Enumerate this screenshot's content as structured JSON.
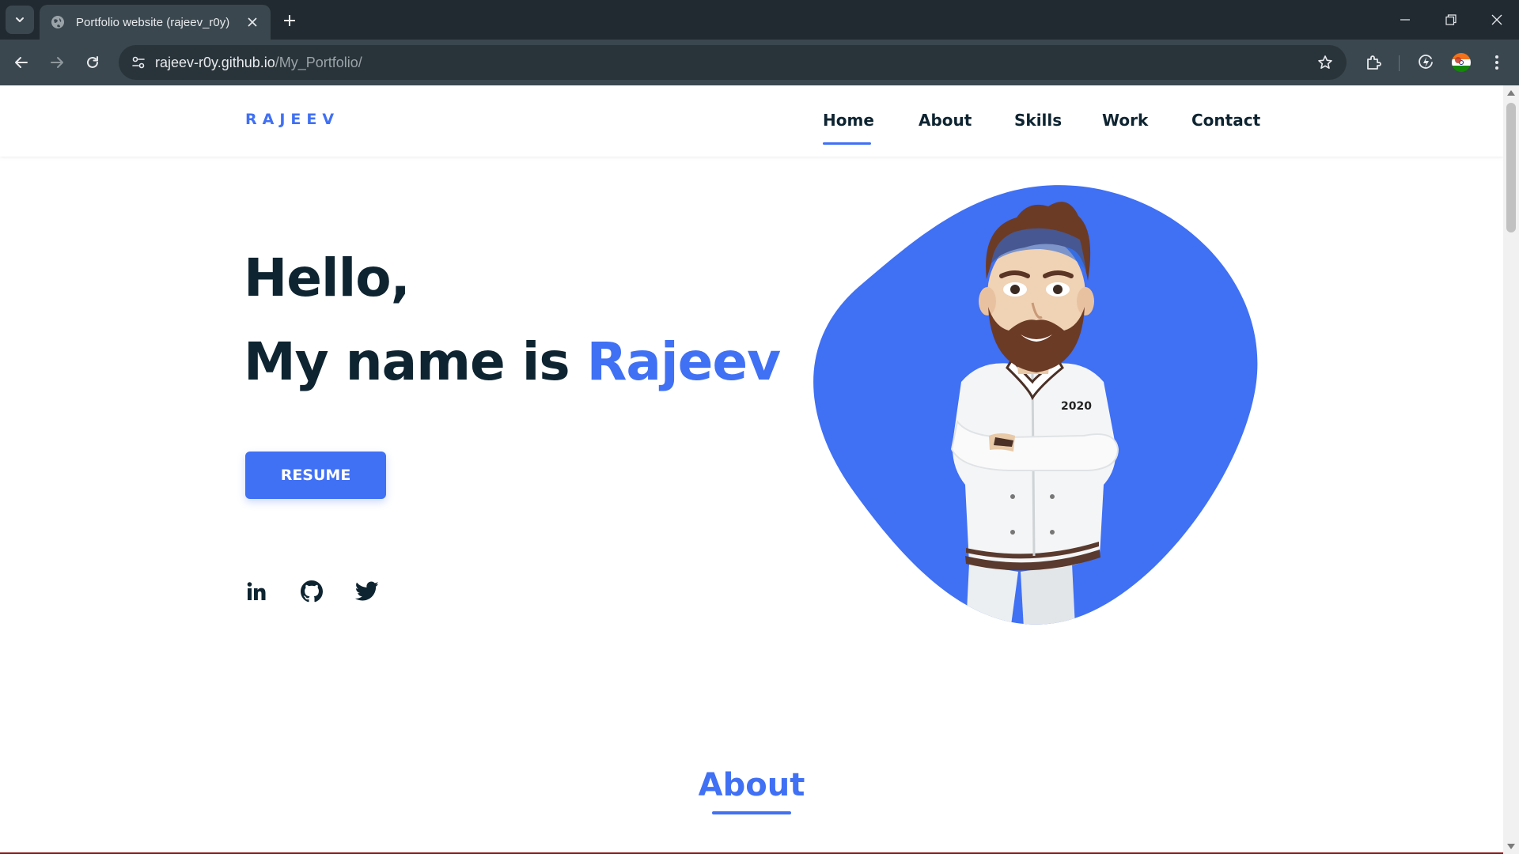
{
  "browser": {
    "tab": {
      "title": "Portfolio website (rajeev_r0y)",
      "favicon": "globe-icon"
    },
    "address_bar": {
      "host": "rajeev-r0y.github.io",
      "path": "/My_Portfolio/"
    },
    "icons": [
      "tab-search-icon",
      "globe-icon",
      "close-icon",
      "plus-icon",
      "minimize-icon",
      "restore-icon",
      "window-close-icon",
      "back-arrow-icon",
      "forward-arrow-icon",
      "reload-icon",
      "site-info-icon",
      "star-icon",
      "extensions-icon",
      "performance-icon",
      "profile-avatar",
      "kebab-menu-icon"
    ]
  },
  "site": {
    "logo": "RAJEEV",
    "nav": [
      {
        "label": "Home",
        "active": true
      },
      {
        "label": "About",
        "active": false
      },
      {
        "label": "Skills",
        "active": false
      },
      {
        "label": "Work",
        "active": false
      },
      {
        "label": "Contact",
        "active": false
      }
    ],
    "hero": {
      "line1": "Hello,",
      "line2_prefix": "My name is ",
      "name": "Rajeev",
      "button_label": "RESUME",
      "jacket_text": "2020"
    },
    "social": [
      "linkedin-icon",
      "github-icon",
      "twitter-icon"
    ],
    "section_title": "About"
  },
  "colors": {
    "accent": "#4070f4",
    "text_dark": "#0e2431",
    "chrome_dark": "#202a30",
    "chrome_toolbar": "#3a474e"
  }
}
